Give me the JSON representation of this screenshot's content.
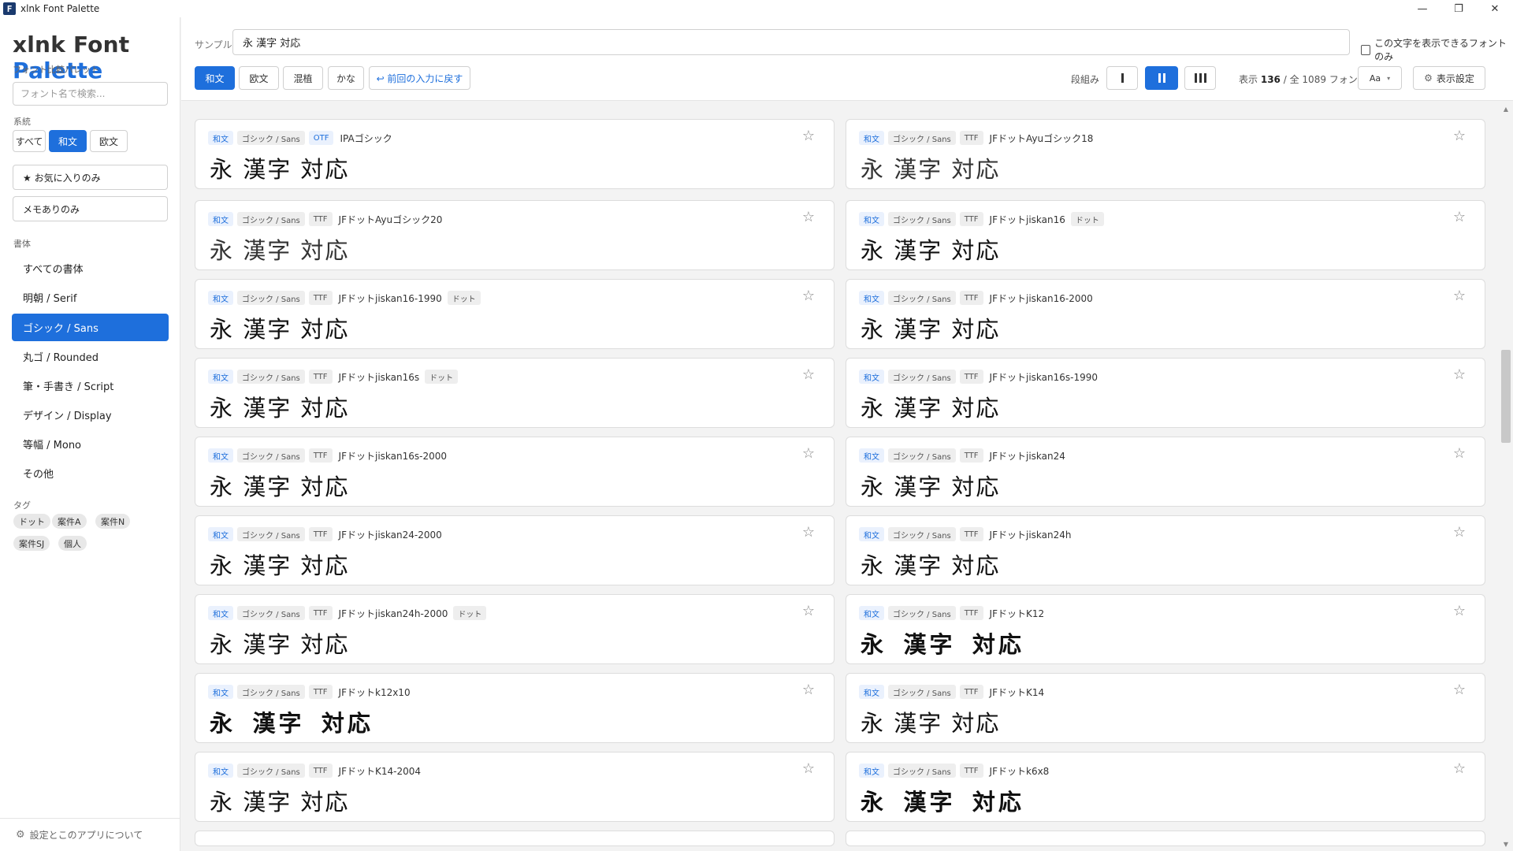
{
  "window": {
    "title": "xlnk Font Palette",
    "icon_letter": "F",
    "minimize": "—",
    "maximize": "❐",
    "close": "✕"
  },
  "sidebar": {
    "logo_part1": "xlnk",
    "logo_part2": "Font",
    "logo_part3": "Palette",
    "subtitle": "フォント比較パレット",
    "search_placeholder": "フォント名で検索...",
    "system_label": "系統",
    "system_options": [
      "すべて",
      "和文",
      "欧文"
    ],
    "favorites_only": "★ お気に入りのみ",
    "memo_only": "メモありのみ",
    "style_label": "書体",
    "styles": [
      "すべての書体",
      "明朝 / Serif",
      "ゴシック / Sans",
      "丸ゴ / Rounded",
      "筆・手書き / Script",
      "デザイン / Display",
      "等幅 / Mono",
      "その他"
    ],
    "tag_label": "タグ",
    "tags": [
      "ドット",
      "案件A",
      "案件N",
      "案件SJ",
      "個人"
    ],
    "footer": "設定とこのアプリについて"
  },
  "toolbar": {
    "sample_label": "サンプル",
    "sample_value": "永 漢字 対応",
    "only_supported": "この文字を表示できるフォントのみ",
    "script_buttons": [
      "和文",
      "欧文",
      "混植",
      "かな"
    ],
    "restore": "↩ 前回の入力に戻す",
    "columns_label": "段組み",
    "count_prefix": "表示",
    "count_shown": "136",
    "count_mid": "/ 全",
    "count_total": "1089",
    "count_suffix": "フォント",
    "aa_label": "Aa",
    "aa_caret": "▾",
    "display_settings": "表示設定"
  },
  "fonts": [
    {
      "lang": "和文",
      "category": "ゴシック / Sans",
      "format": "OTF",
      "name": "IPAゴシック",
      "tag": "",
      "sample": "永 漢字 対応"
    },
    {
      "lang": "和文",
      "category": "ゴシック / Sans",
      "format": "TTF",
      "name": "JFドットAyuゴシック18",
      "tag": "",
      "sample": "永 漢字 対応"
    },
    {
      "lang": "和文",
      "category": "ゴシック / Sans",
      "format": "TTF",
      "name": "JFドットAyuゴシック20",
      "tag": "",
      "sample": "永 漢字 対応"
    },
    {
      "lang": "和文",
      "category": "ゴシック / Sans",
      "format": "TTF",
      "name": "JFドットjiskan16",
      "tag": "ドット",
      "sample": "永 漢字 対応"
    },
    {
      "lang": "和文",
      "category": "ゴシック / Sans",
      "format": "TTF",
      "name": "JFドットjiskan16-1990",
      "tag": "ドット",
      "sample": "永 漢字 対応"
    },
    {
      "lang": "和文",
      "category": "ゴシック / Sans",
      "format": "TTF",
      "name": "JFドットjiskan16-2000",
      "tag": "",
      "sample": "永 漢字 対応"
    },
    {
      "lang": "和文",
      "category": "ゴシック / Sans",
      "format": "TTF",
      "name": "JFドットjiskan16s",
      "tag": "ドット",
      "sample": "永 漢字 対応"
    },
    {
      "lang": "和文",
      "category": "ゴシック / Sans",
      "format": "TTF",
      "name": "JFドットjiskan16s-1990",
      "tag": "",
      "sample": "永 漢字 対応"
    },
    {
      "lang": "和文",
      "category": "ゴシック / Sans",
      "format": "TTF",
      "name": "JFドットjiskan16s-2000",
      "tag": "",
      "sample": "永 漢字 対応"
    },
    {
      "lang": "和文",
      "category": "ゴシック / Sans",
      "format": "TTF",
      "name": "JFドットjiskan24",
      "tag": "",
      "sample": "永 漢字 対応"
    },
    {
      "lang": "和文",
      "category": "ゴシック / Sans",
      "format": "TTF",
      "name": "JFドットjiskan24-2000",
      "tag": "",
      "sample": "永 漢字 対応"
    },
    {
      "lang": "和文",
      "category": "ゴシック / Sans",
      "format": "TTF",
      "name": "JFドットjiskan24h",
      "tag": "",
      "sample": "永 漢字 対応"
    },
    {
      "lang": "和文",
      "category": "ゴシック / Sans",
      "format": "TTF",
      "name": "JFドットjiskan24h-2000",
      "tag": "ドット",
      "sample": "永 漢字 対応"
    },
    {
      "lang": "和文",
      "category": "ゴシック / Sans",
      "format": "TTF",
      "name": "JFドットK12",
      "tag": "",
      "sample": "永 漢字 対応"
    },
    {
      "lang": "和文",
      "category": "ゴシック / Sans",
      "format": "TTF",
      "name": "JFドットk12x10",
      "tag": "",
      "sample": "永 漢字 対応"
    },
    {
      "lang": "和文",
      "category": "ゴシック / Sans",
      "format": "TTF",
      "name": "JFドットK14",
      "tag": "",
      "sample": "永 漢字 対応"
    },
    {
      "lang": "和文",
      "category": "ゴシック / Sans",
      "format": "TTF",
      "name": "JFドットK14-2004",
      "tag": "",
      "sample": "永 漢字 対応"
    },
    {
      "lang": "和文",
      "category": "ゴシック / Sans",
      "format": "TTF",
      "name": "JFドットk6x8",
      "tag": "",
      "sample": "永 漢字 対応"
    }
  ],
  "colors": {
    "accent": "#1e6fdc"
  }
}
